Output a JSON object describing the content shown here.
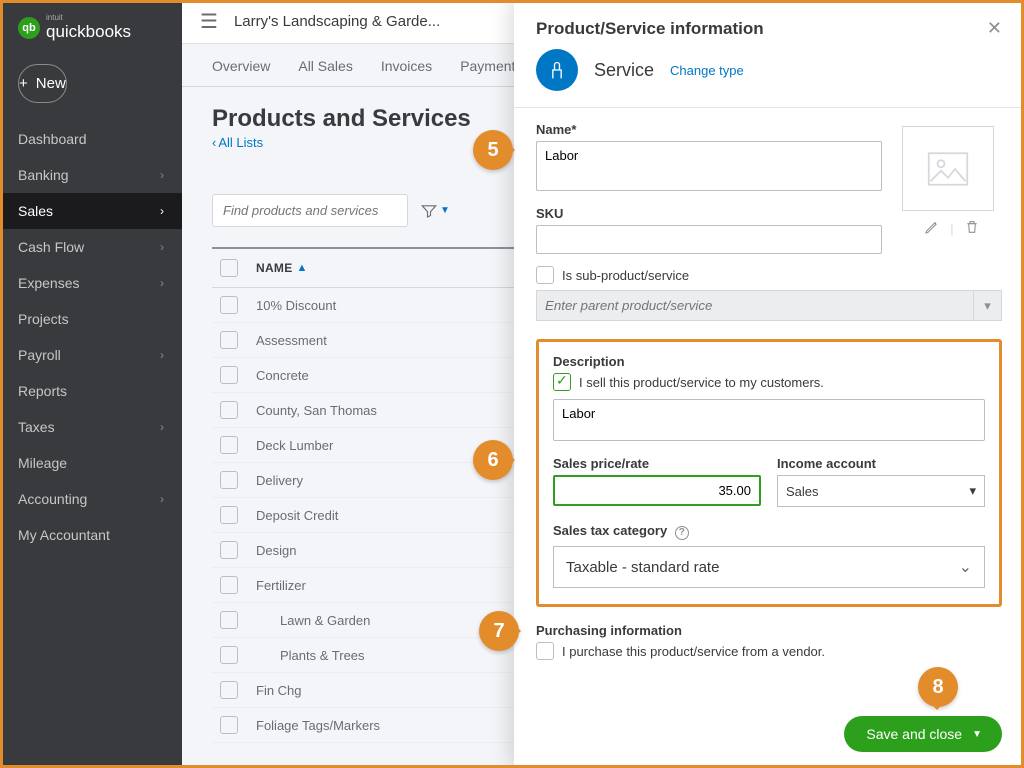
{
  "brand": {
    "intuit": "intuit",
    "name": "quickbooks",
    "logo_letters": "qb"
  },
  "new_button": "New",
  "nav": [
    {
      "label": "Dashboard",
      "chev": false
    },
    {
      "label": "Banking",
      "chev": true
    },
    {
      "label": "Sales",
      "chev": true,
      "active": true
    },
    {
      "label": "Cash Flow",
      "chev": true
    },
    {
      "label": "Expenses",
      "chev": true
    },
    {
      "label": "Projects",
      "chev": false
    },
    {
      "label": "Payroll",
      "chev": true
    },
    {
      "label": "Reports",
      "chev": false
    },
    {
      "label": "Taxes",
      "chev": true
    },
    {
      "label": "Mileage",
      "chev": false
    },
    {
      "label": "Accounting",
      "chev": true
    },
    {
      "label": "My Accountant",
      "chev": false
    }
  ],
  "company": "Larry's Landscaping & Garde...",
  "tabs": [
    "Overview",
    "All Sales",
    "Invoices",
    "Payment Lin"
  ],
  "page_title": "Products and Services",
  "all_lists": "All Lists",
  "search_placeholder": "Find products and services",
  "name_header": "NAME",
  "rows": [
    {
      "name": "10% Discount"
    },
    {
      "name": "Assessment"
    },
    {
      "name": "Concrete"
    },
    {
      "name": "County, San Thomas"
    },
    {
      "name": "Deck Lumber"
    },
    {
      "name": "Delivery"
    },
    {
      "name": "Deposit Credit"
    },
    {
      "name": "Design"
    },
    {
      "name": "Fertilizer"
    },
    {
      "name": "Lawn & Garden",
      "indent": true
    },
    {
      "name": "Plants & Trees",
      "indent": true
    },
    {
      "name": "Fin Chg"
    },
    {
      "name": "Foliage Tags/Markers"
    }
  ],
  "panel": {
    "title": "Product/Service information",
    "type_label": "Service",
    "change_type": "Change type",
    "name_label": "Name*",
    "name_value": "Labor",
    "sku_label": "SKU",
    "sku_value": "",
    "sub_label": "Is sub-product/service",
    "parent_placeholder": "Enter parent product/service",
    "desc_label": "Description",
    "sell_label": "I sell this product/service to my customers.",
    "desc_value": "Labor",
    "rate_label": "Sales price/rate",
    "rate_value": "35.00",
    "income_label": "Income account",
    "income_value": "Sales",
    "tax_label": "Sales tax category",
    "tax_value": "Taxable - standard rate",
    "purchasing_label": "Purchasing information",
    "purchase_checkbox": "I purchase this product/service from a vendor.",
    "save_label": "Save and close"
  },
  "callouts": {
    "c5": "5",
    "c6": "6",
    "c7": "7",
    "c8": "8"
  }
}
